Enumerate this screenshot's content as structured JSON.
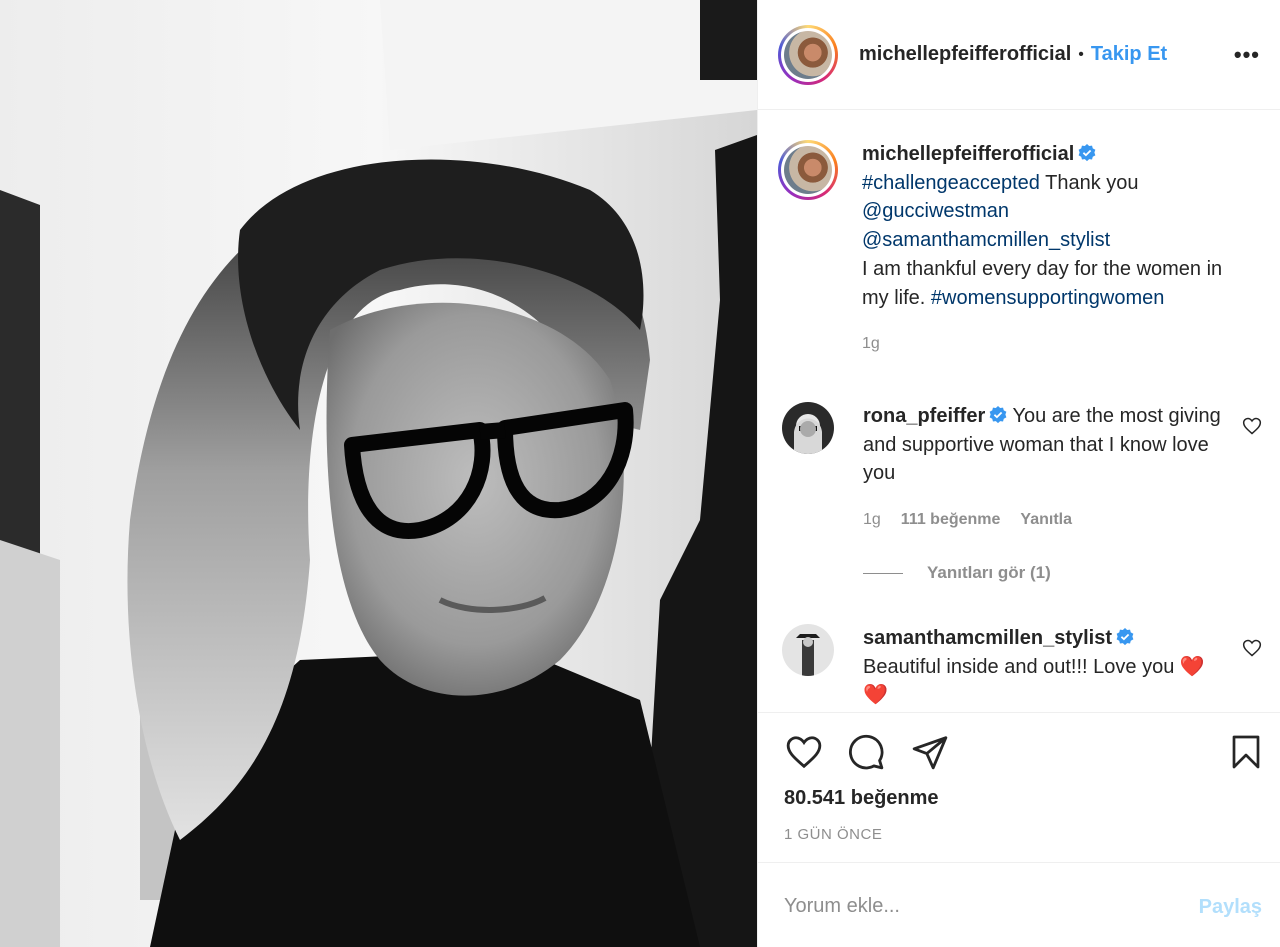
{
  "post": {
    "author": "michellepfeifferofficial",
    "separator": "•",
    "follow_label": "Takip Et",
    "more_label": "•••",
    "caption": {
      "author": "michellepfeifferofficial",
      "hashtag1": "#challengeaccepted",
      "text1": " Thank you",
      "mention1": "@gucciwestman",
      "mention2": "@samanthamcmillen_stylist",
      "text2": "I am thankful every day for the women in my life. ",
      "hashtag2": "#womensupportingwomen",
      "time": "1g"
    },
    "likes_count": "80.541 beğenme",
    "posted_ago": "1 GÜN ÖNCE"
  },
  "comments": [
    {
      "author": "rona_pfeiffer",
      "text": "You are the most giving and supportive woman that I know love you",
      "time": "1g",
      "likes": "111 beğenme",
      "reply_label": "Yanıtla",
      "view_replies": "Yanıtları gör (1)"
    },
    {
      "author": "samanthamcmillen_stylist",
      "text": "Beautiful inside and out!!! Love you ❤️❤️"
    }
  ],
  "comment_box": {
    "placeholder": "Yorum ekle...",
    "share_label": "Paylaş"
  },
  "colors": {
    "link": "#00376b",
    "follow": "#3897f0",
    "verified": "#3897f0",
    "share_disabled": "#b2dffc",
    "muted": "#8e8e8e"
  },
  "icons": [
    "verified-badge-icon",
    "more-options-icon",
    "heart-icon",
    "comment-icon",
    "share-icon",
    "bookmark-icon",
    "like-comment-heart-icon"
  ]
}
